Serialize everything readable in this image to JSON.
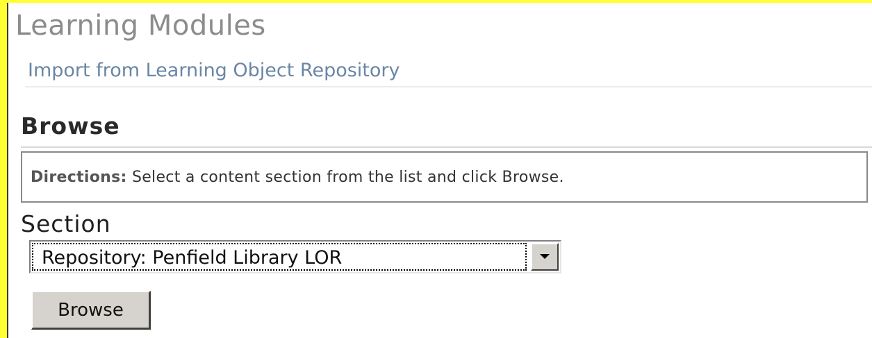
{
  "header": {
    "title": "Learning Modules",
    "subtitle": "Import from Learning Object Repository"
  },
  "browse_section": {
    "heading": "Browse",
    "directions_label": "Directions:",
    "directions_text": " Select a content section from the list and click Browse."
  },
  "form": {
    "section_label": "Section",
    "section_selected": "Repository: Penfield Library LOR",
    "browse_button_label": "Browse"
  },
  "icons": {
    "dropdown": "chevron-down-icon"
  },
  "colors": {
    "frame": "#ffff33",
    "title": "#8c8c8c",
    "subtitle": "#6a86a4",
    "button_face": "#d6d3ce"
  }
}
